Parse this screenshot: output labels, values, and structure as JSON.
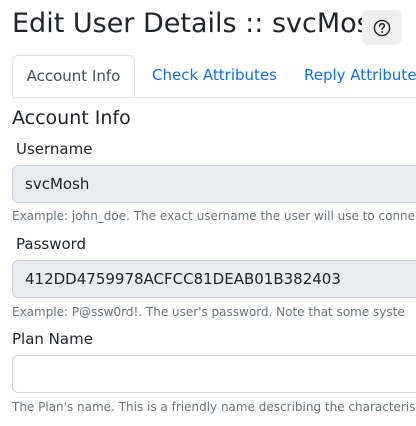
{
  "page": {
    "title": "Edit User Details :: svcMosh",
    "help_icon": "question-circle-icon"
  },
  "tabs": [
    {
      "label": "Account Info",
      "active": true
    },
    {
      "label": "Check Attributes",
      "active": false
    },
    {
      "label": "Reply Attributes",
      "active": false
    }
  ],
  "section": {
    "title": "Account Info"
  },
  "fields": {
    "username": {
      "label": "Username",
      "value": "svcMosh",
      "help": "Example: john_doe. The exact username the user will use to conne"
    },
    "password": {
      "label": "Password",
      "value": "412DD4759978ACFCC81DEAB01B382403",
      "help": "Example: P@ssw0rd!. The user's password. Note that some syste"
    },
    "plan_name": {
      "label": "Plan Name",
      "value": "",
      "help": "The Plan's name. This is a friendly name describing the characteris"
    }
  },
  "colors": {
    "link": "#0d6efd",
    "readonly_bg": "#e9ecef",
    "muted_text": "#6c757d"
  }
}
